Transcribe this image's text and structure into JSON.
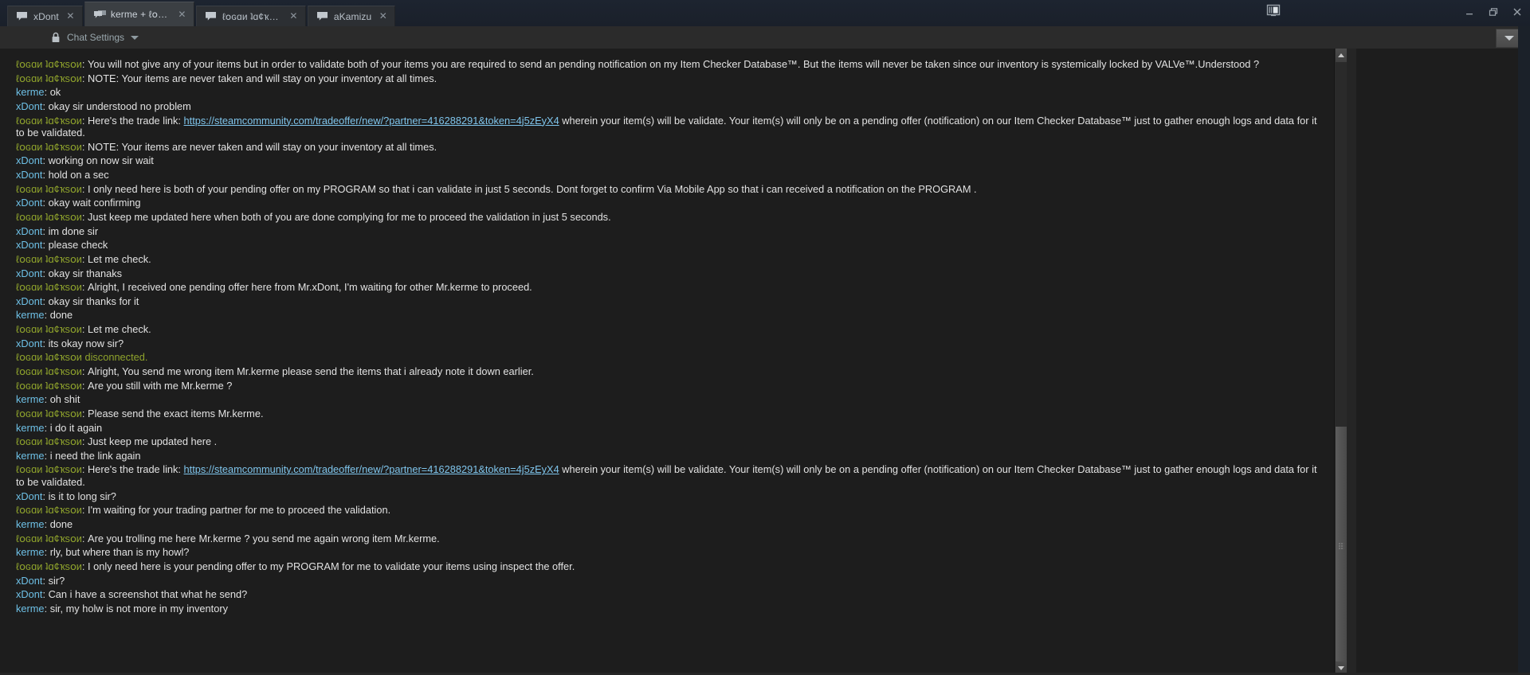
{
  "window": {
    "controls": {
      "minimize": "—",
      "restore": "❐",
      "close": "✕"
    },
    "split_view_icon": "split-view-icon"
  },
  "tabs": [
    {
      "label": "xDont",
      "icon": "chat-bubble-icon",
      "close": "✕",
      "active": false
    },
    {
      "label": "kerme + ℓօɢɑи ?...",
      "icon": "group-chat-icon",
      "close": "✕",
      "active": true
    },
    {
      "label": "ℓօɢɑи ʇɑ¢ҡsօи",
      "icon": "chat-bubble-icon",
      "close": "✕",
      "active": false
    },
    {
      "label": "aKamizu",
      "icon": "chat-bubble-icon",
      "close": "✕",
      "active": false
    }
  ],
  "toolbar": {
    "lock_icon": "lock-icon",
    "chat_settings_label": "Chat Settings",
    "caret": "▼",
    "dropdown_caret": "▼"
  },
  "users": {
    "logan": "ℓօɢɑи ʇɑ¢ҡsօи",
    "kerme": "kerme",
    "xdont": "xDont"
  },
  "trade_link": "https://steamcommunity.com/tradeoffer/new/?partner=416288291&token=4j5zEyX4",
  "messages": [
    {
      "user": "logan",
      "role": "other",
      "text": "You will not give any of your items but in order to validate both of your items you are required to send an pending notification on my Item Checker Database™. But the items will never be taken since our inventory is systemically locked by VALVe™.Understood ?"
    },
    {
      "user": "logan",
      "role": "other",
      "text": "NOTE: Your items are never taken and will stay on your inventory at all times."
    },
    {
      "user": "kerme",
      "role": "self",
      "text": "ok"
    },
    {
      "user": "xdont",
      "role": "self",
      "text": "okay sir understood no problem"
    },
    {
      "user": "logan",
      "role": "other",
      "text_before": "Here's the trade link: ",
      "link": true,
      "text_after": " wherein your item(s) will be validate. Your item(s) will only be on a pending offer (notification) on our Item Checker Database™ just to gather enough logs and data for it to be validated."
    },
    {
      "user": "logan",
      "role": "other",
      "text": "NOTE: Your items are never taken and will stay on your inventory at all times."
    },
    {
      "user": "xdont",
      "role": "self",
      "text": "working on now sir wait"
    },
    {
      "user": "xdont",
      "role": "self",
      "text": "hold on a sec"
    },
    {
      "user": "logan",
      "role": "other",
      "text": "I only need here is both of your pending offer on my PROGRAM so that i can validate in just 5 seconds. Dont forget to confirm Via Mobile App so that i can received a notification on the PROGRAM ."
    },
    {
      "user": "xdont",
      "role": "self",
      "text": "okay wait confirming"
    },
    {
      "user": "logan",
      "role": "other",
      "text": "Just keep me updated here when both of you are done complying for me to proceed the validation in just 5 seconds."
    },
    {
      "user": "xdont",
      "role": "self",
      "text": "im done sir"
    },
    {
      "user": "xdont",
      "role": "self",
      "text": "please check"
    },
    {
      "user": "logan",
      "role": "other",
      "text": "Let me check."
    },
    {
      "user": "xdont",
      "role": "self",
      "text": "okay sir thanaks"
    },
    {
      "user": "logan",
      "role": "other",
      "text": "Alright, I received one pending offer here from Mr.xDont, I'm waiting for other Mr.kerme to proceed."
    },
    {
      "user": "xdont",
      "role": "self",
      "text": "okay sir thanks for it"
    },
    {
      "user": "kerme",
      "role": "self",
      "text": "done"
    },
    {
      "user": "logan",
      "role": "other",
      "text": "Let me check."
    },
    {
      "user": "xdont",
      "role": "self",
      "text": "its okay now sir?"
    },
    {
      "system": true,
      "text": "ℓօɢɑи ʇɑ¢ҡsօи disconnected."
    },
    {
      "user": "logan",
      "role": "other",
      "text": "Alright, You send me wrong item Mr.kerme please send the items that i already note it down earlier."
    },
    {
      "user": "logan",
      "role": "other",
      "text": "Are you still with me Mr.kerme ?"
    },
    {
      "user": "kerme",
      "role": "self",
      "text": "oh shit"
    },
    {
      "user": "logan",
      "role": "other",
      "text": "Please send the exact items Mr.kerme."
    },
    {
      "user": "kerme",
      "role": "self",
      "text": "i do it again"
    },
    {
      "user": "logan",
      "role": "other",
      "text": "Just keep me updated here ."
    },
    {
      "user": "kerme",
      "role": "self",
      "text": "i need the link again"
    },
    {
      "user": "logan",
      "role": "other",
      "text_before": "Here's the trade link: ",
      "link": true,
      "text_after": " wherein your item(s) will be validate. Your item(s) will only be on a pending offer (notification) on our Item Checker Database™ just to gather enough logs and data for it to be validated."
    },
    {
      "user": "xdont",
      "role": "self",
      "text": "is it to long sir?"
    },
    {
      "user": "logan",
      "role": "other",
      "text": "I'm waiting for your trading partner for me to proceed the validation."
    },
    {
      "user": "kerme",
      "role": "self",
      "text": "done"
    },
    {
      "user": "logan",
      "role": "other",
      "text": "Are you trolling me here Mr.kerme ? you send me again wrong item Mr.kerme."
    },
    {
      "user": "kerme",
      "role": "self",
      "text": "rly, but where than is my howl?"
    },
    {
      "user": "logan",
      "role": "other",
      "text": "I only need here is your pending offer to my PROGRAM for me to validate your items using inspect the offer."
    },
    {
      "user": "xdont",
      "role": "self",
      "text": "sir?"
    },
    {
      "user": "xdont",
      "role": "self",
      "text": "Can i have a screenshot  that what he send?"
    },
    {
      "user": "kerme",
      "role": "self",
      "text": "sir, my holw is not more in my inventory"
    }
  ],
  "colors": {
    "name_other": "#8fa32c",
    "name_self": "#6ec0e6",
    "link": "#7fc5ec",
    "body_text": "#e2e2e2",
    "chat_bg": "#1d1d1d",
    "toolbar_bg": "#2b2b2b",
    "titlebar_bg": "#1d2430",
    "tab_active_bg": "#3b3f43"
  },
  "scrollbar": {
    "up_arrow": "▲",
    "down_arrow": "▼"
  }
}
